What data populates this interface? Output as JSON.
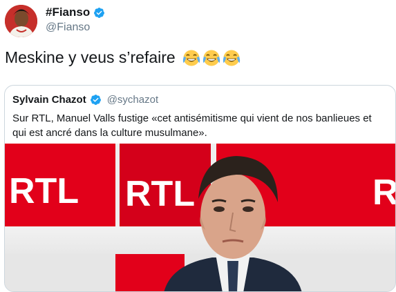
{
  "tweet": {
    "display_name": "#Fianso",
    "handle": "@Fianso",
    "text": "Meskine y veus s’refaire",
    "emojis": [
      "face-with-tears-of-joy",
      "face-with-tears-of-joy",
      "face-with-tears-of-joy"
    ],
    "verified": true
  },
  "quoted_tweet": {
    "display_name": "Sylvain Chazot",
    "handle": "@sychazot",
    "verified": true,
    "text": "Sur RTL, Manuel Valls fustige «cet antisémitisme qui vient de nos banlieues et qui est ancré dans la culture musulmane».",
    "media": {
      "logos": [
        "RTL",
        "RTL",
        "RTL"
      ]
    }
  },
  "colors": {
    "verified_blue": "#1da1f2",
    "rtl_red": "#e2001a",
    "secondary_text": "#657786"
  }
}
